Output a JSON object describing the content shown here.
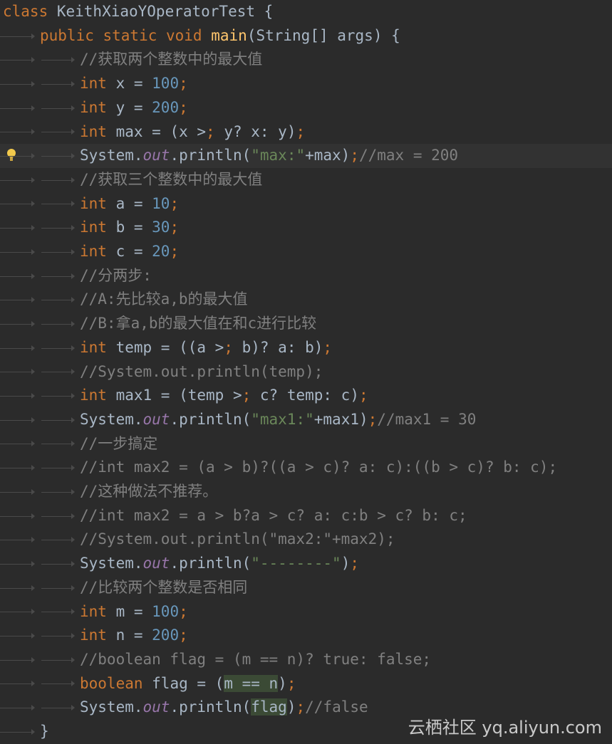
{
  "code": {
    "class_keyword": "class",
    "class_name": "KeithXiaoYOperatorTest",
    "class_open": " {",
    "main_decl": [
      "public",
      "static",
      "void",
      "main",
      "(String[] args) {"
    ],
    "lines": [
      "//获取两个整数中的最大值",
      "int x = 100;",
      "int y = 200;",
      "int max = (x > y? x: y);",
      "System.out.println(\"max:\"+max);//max = 200",
      "//获取三个整数中的最大值",
      "int a = 10;",
      "int b = 30;",
      "int c = 20;",
      "//分两步:",
      "//A:先比较a,b的最大值",
      "//B:拿a,b的最大值在和c进行比较",
      "int temp = ((a > b)? a: b);",
      "//System.out.println(temp);",
      "int max1 = (temp > c? temp: c);",
      "System.out.println(\"max1:\"+max1);//max1 = 30",
      "//一步搞定",
      "//int max2 = (a > b)?((a > c)? a: c):((b > c)? b: c);",
      "//这种做法不推荐。",
      "//int max2 = a > b?a > c? a: c:b > c? b: c;",
      "//System.out.println(\"max2:\"+max2);",
      "System.out.println(\"--------\");",
      "//比较两个整数是否相同",
      "int m = 100;",
      "int n = 200;",
      "//boolean flag = (m == n)? true: false;",
      "boolean flag = (m == n);",
      "System.out.println(flag);//false"
    ],
    "close_brace": "}"
  },
  "watermark": "云栖社区 yq.aliyun.com",
  "icons": {
    "bulb": "lightbulb-icon"
  },
  "colors": {
    "background": "#2b2b2b",
    "keyword": "#cc7832",
    "number": "#6897bb",
    "string": "#6a8759",
    "comment": "#808080",
    "method": "#ffc66d",
    "static_field": "#9876aa"
  }
}
